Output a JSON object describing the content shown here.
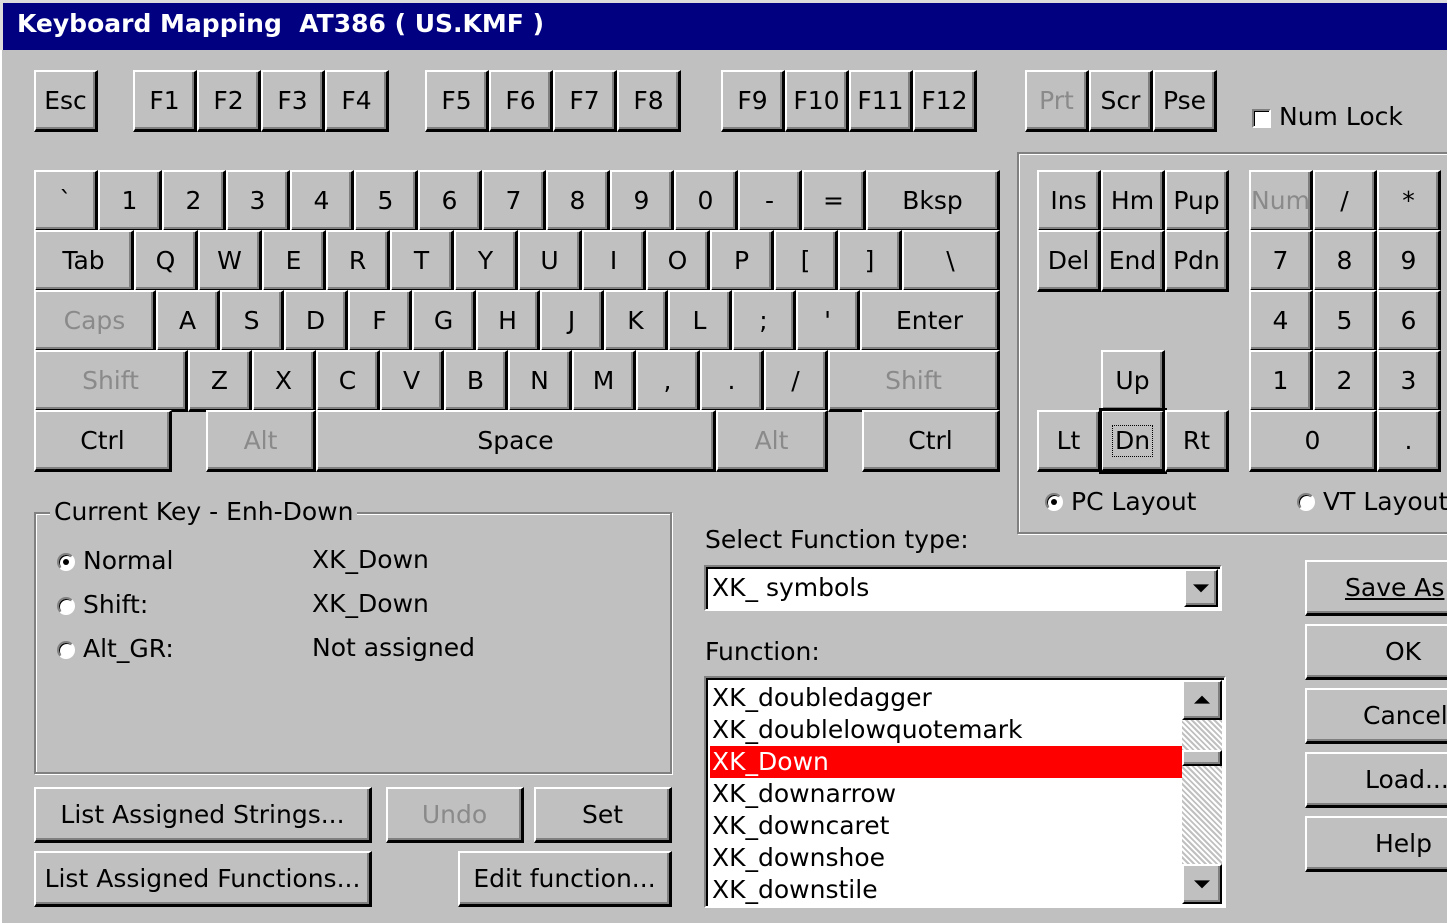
{
  "window": {
    "title": "Keyboard Mapping  AT386 ( US.KMF )"
  },
  "keys": {
    "esc": "Esc",
    "f1": "F1",
    "f2": "F2",
    "f3": "F3",
    "f4": "F4",
    "f5": "F5",
    "f6": "F6",
    "f7": "F7",
    "f8": "F8",
    "f9": "F9",
    "f10": "F10",
    "f11": "F11",
    "f12": "F12",
    "prt": "Prt",
    "scr": "Scr",
    "pse": "Pse",
    "backquote": "`",
    "k1": "1",
    "k2": "2",
    "k3": "3",
    "k4": "4",
    "k5": "5",
    "k6": "6",
    "k7": "7",
    "k8": "8",
    "k9": "9",
    "k0": "0",
    "minus": "-",
    "equals": "=",
    "bksp": "Bksp",
    "tab": "Tab",
    "q": "Q",
    "w": "W",
    "e": "E",
    "r": "R",
    "t": "T",
    "y": "Y",
    "u": "U",
    "i": "I",
    "o": "O",
    "p": "P",
    "lbracket": "[",
    "rbracket": "]",
    "backslash": "\\",
    "caps": "Caps",
    "a": "A",
    "s": "S",
    "d": "D",
    "f": "F",
    "g": "G",
    "h": "H",
    "j": "J",
    "k": "K",
    "l": "L",
    "semicolon": ";",
    "quote": "'",
    "enter": "Enter",
    "lshift": "Shift",
    "z": "Z",
    "x": "X",
    "c": "C",
    "v": "V",
    "b": "B",
    "n": "N",
    "m": "M",
    "comma": ",",
    "period": ".",
    "slash": "/",
    "rshift": "Shift",
    "lctrl": "Ctrl",
    "lalt": "Alt",
    "space": "Space",
    "ralt": "Alt",
    "rctrl": "Ctrl",
    "ins": "Ins",
    "hm": "Hm",
    "pup": "Pup",
    "del": "Del",
    "end": "End",
    "pdn": "Pdn",
    "up": "Up",
    "lt": "Lt",
    "dn": "Dn",
    "rt": "Rt",
    "num": "Num",
    "np_div": "/",
    "np_mul": "*",
    "np7": "7",
    "np8": "8",
    "np9": "9",
    "np4": "4",
    "np5": "5",
    "np6": "6",
    "np1": "1",
    "np2": "2",
    "np3": "3",
    "np0": "0",
    "np_dot": "."
  },
  "numlock_label": "Num Lock",
  "layout_options": {
    "pc": "PC Layout",
    "vt": "VT Layout",
    "selected": "pc"
  },
  "current_key": {
    "legend": "Current Key - Enh-Down",
    "rows": [
      {
        "label": "Normal",
        "value": "XK_Down",
        "selected": true
      },
      {
        "label": "Shift:",
        "value": "XK_Down",
        "selected": false
      },
      {
        "label": "Alt_GR:",
        "value": "Not assigned",
        "selected": false
      }
    ]
  },
  "select_function": {
    "label": "Select Function type:",
    "value": "XK_ symbols"
  },
  "function_list": {
    "label": "Function:",
    "items": [
      "XK_doubledagger",
      "XK_doublelowquotemark",
      "XK_Down",
      "XK_downarrow",
      "XK_downcaret",
      "XK_downshoe",
      "XK_downstile"
    ],
    "selected_index": 2
  },
  "buttons": {
    "list_strings": "List Assigned Strings...",
    "undo": "Undo",
    "set": "Set",
    "list_functions": "List Assigned Functions...",
    "edit_function": "Edit function...",
    "save_as": "Save As",
    "ok": "OK",
    "cancel": "Cancel",
    "load": "Load...",
    "help": "Help"
  },
  "colors": {
    "titlebar": "#000080",
    "face": "#c0c0c0",
    "selection": "#ff0000"
  }
}
